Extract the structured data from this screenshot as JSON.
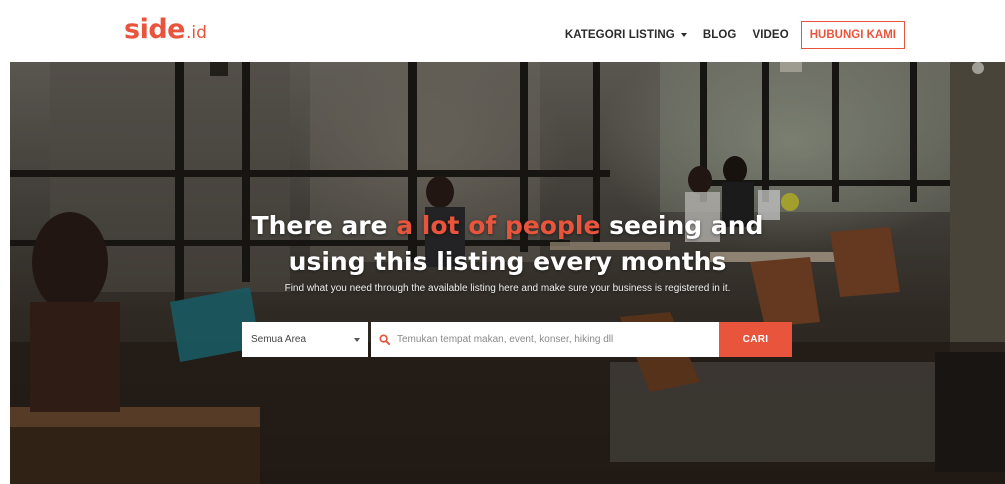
{
  "brand": {
    "logo_main": "side",
    "logo_suffix": ".id",
    "accent_color": "#e8553c"
  },
  "nav": {
    "items": [
      {
        "label": "KATEGORI LISTING",
        "has_dropdown": true
      },
      {
        "label": "BLOG"
      },
      {
        "label": "VIDEO"
      }
    ],
    "cta_label": "HUBUNGI KAMI"
  },
  "hero": {
    "headline_before": "There are ",
    "headline_accent": "a lot of people",
    "headline_after": " seeing and",
    "headline_line2": "using this listing every months",
    "subline": "Find what you need through the available listing here and make sure your business is registered in it."
  },
  "search": {
    "area_value": "Semua Area",
    "placeholder": "Temukan tempat makan, event, konser, hiking dll",
    "button_label": "CARI"
  },
  "icons": {
    "search": "search-icon",
    "dropdown": "chevron-down-icon"
  }
}
